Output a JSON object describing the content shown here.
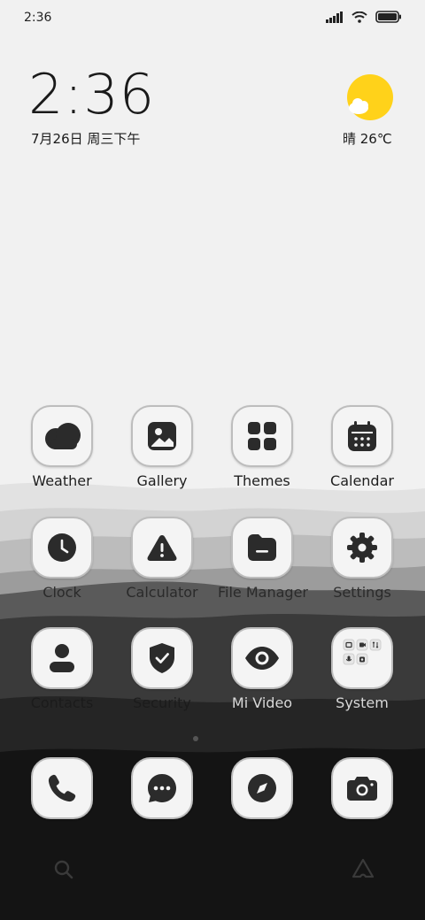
{
  "status_bar": {
    "time": "2:36",
    "icons": [
      "signal-icon",
      "wifi-icon",
      "battery-icon"
    ]
  },
  "clock_widget": {
    "time": "2:36",
    "date": "7月26日 周三下午"
  },
  "weather_widget": {
    "icon": "sun-cloud-icon",
    "summary": "晴 26℃"
  },
  "apps": [
    {
      "label": "Weather",
      "icon": "weather-cloud-icon"
    },
    {
      "label": "Gallery",
      "icon": "gallery-icon"
    },
    {
      "label": "Themes",
      "icon": "themes-grid-icon"
    },
    {
      "label": "Calendar",
      "icon": "calendar-icon"
    },
    {
      "label": "Clock",
      "icon": "clock-icon"
    },
    {
      "label": "Calculator",
      "icon": "warning-triangle-icon"
    },
    {
      "label": "File Manager",
      "icon": "folder-icon"
    },
    {
      "label": "Settings",
      "icon": "gear-icon"
    },
    {
      "label": "Contacts",
      "icon": "person-icon"
    },
    {
      "label": "Security",
      "icon": "shield-check-icon"
    },
    {
      "label": "Mi Video",
      "icon": "eye-icon"
    },
    {
      "label": "System",
      "icon": "folder-grid-icon"
    }
  ],
  "page_indicator": {
    "pages": 2,
    "current": 1
  },
  "dock": [
    {
      "icon": "phone-icon"
    },
    {
      "icon": "message-icon"
    },
    {
      "icon": "compass-icon"
    },
    {
      "icon": "camera-icon"
    }
  ],
  "bottom_bar": {
    "left_icon": "search-icon",
    "right_icon": "assistant-icon"
  },
  "colors": {
    "sun": "#ffd21a",
    "icon_fill": "#2b2b2b",
    "tile_bg": "#f4f4f4"
  }
}
